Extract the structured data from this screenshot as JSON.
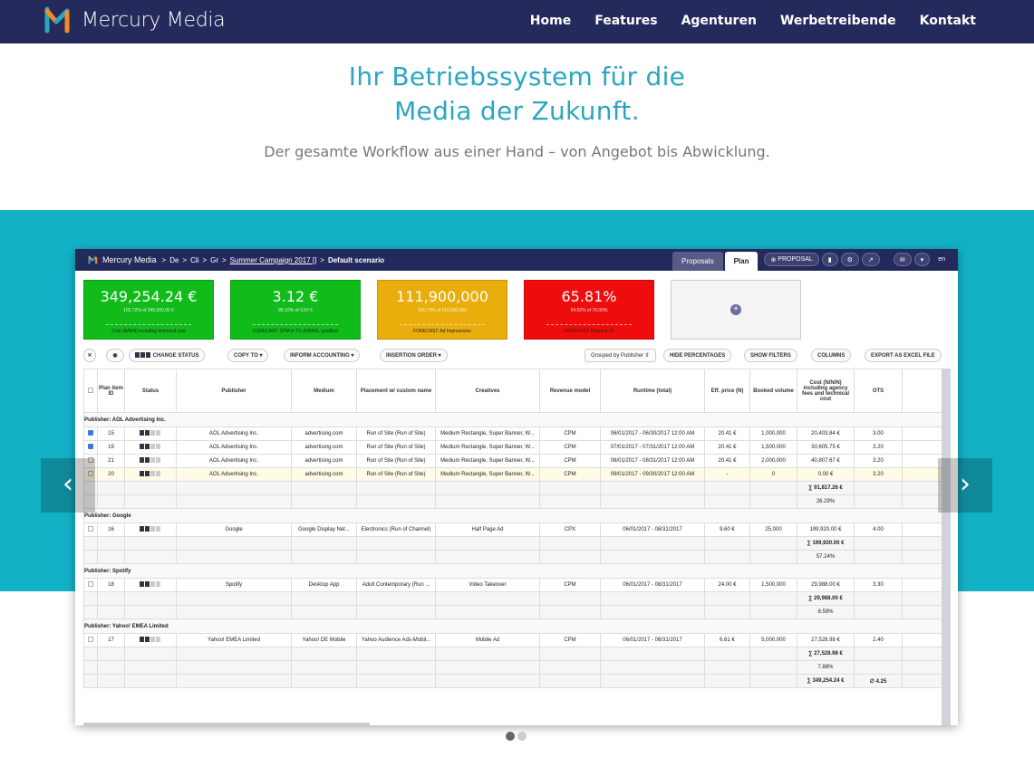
{
  "site": {
    "brand": "Mercury Media",
    "nav": [
      "Home",
      "Features",
      "Agenturen",
      "Werbetreibende",
      "Kontakt"
    ]
  },
  "hero": {
    "line1": "Ihr Betriebssystem für die",
    "line2": "Media der Zukunft.",
    "sub": "Der gesamte Workflow aus einer Hand – von Angebot bis Abwicklung."
  },
  "app": {
    "brand": "Mercury Media",
    "crumbs": [
      "De",
      "Cli",
      "Gr",
      "Summer Campaign 2017 []",
      "Default scenario"
    ],
    "tabs": [
      "Proposals",
      "Plan"
    ],
    "proposal_btn": "PROPOSAL",
    "lang": "en",
    "kpis": [
      {
        "value": "349,254.24 €",
        "sub": "102.72% of 340,000.00 €",
        "label": "Cost (N/N/N) including technical cost",
        "color": "#10bb1a"
      },
      {
        "value": "3.12 €",
        "sub": "88.10% of 3.50 €",
        "label": "FORECAST: CPM in TG (N/N/N), qualified",
        "color": "#10bb1a"
      },
      {
        "value": "111,900,000",
        "sub": "101.73% of 110,000,000",
        "label": "FORECAST: Ad Impressions",
        "color": "#e9ad0c"
      },
      {
        "value": "65.81%",
        "sub": "94.02% of 70.00%",
        "label": "FORECAST: Reach in %",
        "color": "#ef0c0c"
      }
    ],
    "toolbar": {
      "change_status": "CHANGE STATUS",
      "copy_to": "COPY TO",
      "inform": "INFORM ACCOUNTING",
      "insertion": "INSERTION ORDER",
      "grouped": "Grouped by Publisher",
      "hide": "HIDE PERCENTAGES",
      "filters": "SHOW FILTERS",
      "columns": "COLUMNS",
      "export": "EXPORT AS EXCEL FILE"
    },
    "columns": [
      "Plan item ID",
      "Status",
      "Publisher",
      "Medium",
      "Placement w/ custom name",
      "Creatives",
      "Revenue model",
      "Runtime (total)",
      "Eff. price (N)",
      "Booked volume",
      "Cost (N/N/N) including agency fees and technical cost",
      "OTS"
    ],
    "groups": [
      {
        "title": "Publisher: AOL Advertising Inc.",
        "rows": [
          {
            "id": "15",
            "pub": "AOL Advertising Inc.",
            "med": "advertising.com",
            "place": "Run of Site (Run of Site)",
            "cre": "Medium Rectangle, Super Banner, W...",
            "model": "CPM",
            "run": "06/01/2017 - 06/30/2017 12:00 AM",
            "price": "20.41 €",
            "vol": "1,000,000",
            "cost": "20,403.84 €",
            "ots": "3.00",
            "chk": true
          },
          {
            "id": "19",
            "pub": "AOL Advertising Inc.",
            "med": "advertising.com",
            "place": "Run of Site (Run of Site)",
            "cre": "Medium Rectangle, Super Banner, W...",
            "model": "CPM",
            "run": "07/01/2017 - 07/31/2017 12:00 AM",
            "price": "20.41 €",
            "vol": "1,500,000",
            "cost": "30,605.75 €",
            "ots": "3.20",
            "chk": true
          },
          {
            "id": "21",
            "pub": "AOL Advertising Inc.",
            "med": "advertising.com",
            "place": "Run of Site (Run of Site)",
            "cre": "Medium Rectangle, Super Banner, W...",
            "model": "CPM",
            "run": "08/01/2017 - 08/31/2017 12:00 AM",
            "price": "20.41 €",
            "vol": "2,000,000",
            "cost": "40,807.67 €",
            "ots": "3.20",
            "chk": false
          },
          {
            "id": "20",
            "pub": "AOL Advertising Inc.",
            "med": "advertising.com",
            "place": "Run of Site (Run of Site)",
            "cre": "Medium Rectangle, Super Banner, W...",
            "model": "CPM",
            "run": "09/01/2017 - 09/30/2017 12:00 AM",
            "price": "-",
            "vol": "0",
            "cost": "0.00 €",
            "ots": "3.20",
            "chk": false
          }
        ],
        "sum": "∑ 91,817.26 €",
        "pct": "26.29%"
      },
      {
        "title": "Publisher: Google",
        "rows": [
          {
            "id": "16",
            "pub": "Google",
            "med": "Google Display Net...",
            "place": "Electronics (Run of Channel)",
            "cre": "Half Page Ad",
            "model": "CPX",
            "run": "06/01/2017 - 08/31/2017",
            "price": "9.60 €",
            "vol": "25,000",
            "cost": "199,920.00 €",
            "ots": "4.00",
            "chk": false
          }
        ],
        "sum": "∑ 199,920.00 €",
        "pct": "57.24%"
      },
      {
        "title": "Publisher: Spotify",
        "rows": [
          {
            "id": "18",
            "pub": "Spotify",
            "med": "Desktop App",
            "place": "Adult Contemporary (Run ...",
            "cre": "Video Takeover",
            "model": "CPM",
            "run": "06/01/2017 - 08/31/2017",
            "price": "24.00 €",
            "vol": "1,500,000",
            "cost": "29,988.00 €",
            "ots": "3.30",
            "chk": false
          }
        ],
        "sum": "∑ 29,988.00 €",
        "pct": "8.59%"
      },
      {
        "title": "Publisher: Yahoo! EMEA Limited",
        "rows": [
          {
            "id": "17",
            "pub": "Yahoo! EMEA Limited",
            "med": "Yahoo! DE Mobile",
            "place": "Yahoo Audience Ads-Mobil...",
            "cre": "Mobile Ad",
            "model": "CPM",
            "run": "06/01/2017 - 08/31/2017",
            "price": "6.61 €",
            "vol": "5,000,000",
            "cost": "27,528.98 €",
            "ots": "2.40",
            "chk": false
          }
        ],
        "sum": "∑ 27,528.98 €",
        "pct": "7.88%"
      }
    ],
    "total": "∑ 349,254.24 €",
    "total_ots": "∅ 4.25"
  },
  "slider": {
    "prev": "‹",
    "next": "›"
  }
}
